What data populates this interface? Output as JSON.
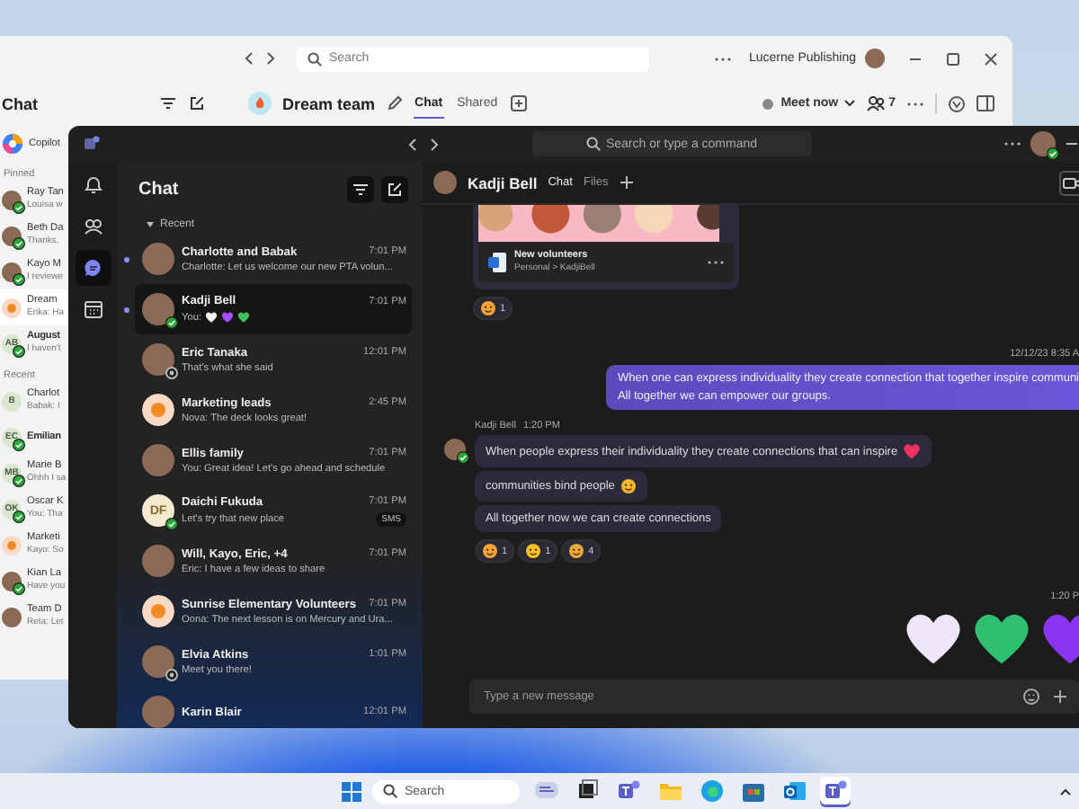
{
  "back_window": {
    "search": {
      "placeholder": "Search"
    },
    "account": "Lucerne Publishing",
    "sidebar": {
      "title": "Chat",
      "copilot": "Copilot",
      "sections": [
        {
          "title": "Pinned",
          "items": [
            {
              "name": "Ray Tan",
              "preview": "Louisa w",
              "avatar": {
                "kind": "photo"
              },
              "available": true,
              "unread": false,
              "selected": false
            },
            {
              "name": "Beth Da",
              "preview": "Thanks,",
              "avatar": {
                "kind": "photo"
              },
              "available": true,
              "unread": false,
              "selected": false
            },
            {
              "name": "Kayo M",
              "preview": "I reviewe",
              "avatar": {
                "kind": "photo"
              },
              "available": true,
              "unread": false,
              "selected": false
            },
            {
              "name": "Dream",
              "preview": "Erika: Ha",
              "avatar": {
                "kind": "icon"
              },
              "unread": false,
              "selected": true
            },
            {
              "name": "August",
              "preview": "I haven't",
              "avatar": {
                "kind": "initials",
                "text": "AB"
              },
              "available": true,
              "unread": true,
              "selected": false
            }
          ]
        },
        {
          "title": "Recent",
          "items": [
            {
              "name": "Charlot",
              "preview": "Babak: I",
              "avatar": {
                "kind": "initials",
                "text": "B"
              },
              "unread": false,
              "selected": false
            },
            {
              "name": "Emilian",
              "avatar": {
                "kind": "initials",
                "text": "EC"
              },
              "available": true,
              "unread": true,
              "selected": false
            },
            {
              "name": "Marie B",
              "preview": "Ohhh I sa",
              "avatar": {
                "kind": "initials",
                "text": "MB"
              },
              "available": true,
              "unread": false,
              "selected": false
            },
            {
              "name": "Oscar K",
              "preview": "You: Tha",
              "avatar": {
                "kind": "initials",
                "text": "OK"
              },
              "available": true,
              "unread": false,
              "selected": false
            },
            {
              "name": "Marketi",
              "preview": "Kayo: So",
              "avatar": {
                "kind": "icon"
              },
              "unread": false,
              "selected": false
            },
            {
              "name": "Kian La",
              "preview": "Have you",
              "avatar": {
                "kind": "photo"
              },
              "available": true,
              "unread": false,
              "selected": false
            },
            {
              "name": "Team D",
              "preview": "Reta: Let",
              "avatar": {
                "kind": "photo"
              },
              "unread": false,
              "selected": false
            }
          ]
        }
      ]
    },
    "conversation": {
      "title": "Dream team",
      "tabs": [
        {
          "label": "Chat",
          "selected": true
        },
        {
          "label": "Shared",
          "selected": false
        }
      ],
      "meet_now": "Meet now",
      "participants": "7"
    }
  },
  "front_window": {
    "search": {
      "placeholder": "Search or type a command"
    },
    "rail": [
      {
        "kind": "activity",
        "selected": false
      },
      {
        "kind": "communities",
        "selected": false
      },
      {
        "kind": "chat",
        "selected": true
      },
      {
        "kind": "calendar",
        "selected": false
      }
    ],
    "chat_list": {
      "title": "Chat",
      "section": "Recent",
      "items": [
        {
          "name": "Charlotte and Babak",
          "time": "7:01 PM",
          "preview": "Charlotte: Let us welcome our new PTA volun...",
          "avatar": {
            "kind": "photo"
          },
          "unread": true,
          "selected": false
        },
        {
          "name": "Kadji Bell",
          "time": "7:01 PM",
          "preview": "You:",
          "preview_hearts": [
            {
              "color": "#f2f2f2"
            },
            {
              "color": "#a64dff"
            },
            {
              "color": "#3fc25a"
            }
          ],
          "avatar": {
            "kind": "photo"
          },
          "available": true,
          "unread": true,
          "selected": true
        },
        {
          "name": "Eric Tanaka",
          "time": "12:01 PM",
          "preview": "That's what she said",
          "avatar": {
            "kind": "photo"
          },
          "available": false,
          "unread": false,
          "selected": false
        },
        {
          "name": "Marketing leads",
          "time": "2:45 PM",
          "preview": "Nova: The deck looks great!",
          "avatar": {
            "kind": "icon"
          },
          "unread": false,
          "selected": false
        },
        {
          "name": "Ellis family",
          "time": "7:01 PM",
          "preview": "You: Great idea! Let's go ahead and schedule",
          "avatar": {
            "kind": "photo"
          },
          "unread": false,
          "selected": false
        },
        {
          "name": "Daichi Fukuda",
          "time": "7:01 PM",
          "preview": "Let's try that new place",
          "badge": "SMS",
          "avatar": {
            "kind": "initials",
            "text": "DF"
          },
          "available": true,
          "unread": false,
          "selected": false
        },
        {
          "name": "Will, Kayo, Eric, +4",
          "time": "7:01 PM",
          "preview": "Eric: I have a few ideas to share",
          "avatar": {
            "kind": "photo"
          },
          "unread": false,
          "selected": false
        },
        {
          "name": "Sunrise Elementary Volunteers",
          "time": "7:01 PM",
          "preview": "Oona: The next lesson is on Mercury and Ura...",
          "avatar": {
            "kind": "icon"
          },
          "unread": false,
          "selected": false
        },
        {
          "name": "Elvia Atkins",
          "time": "1:01 PM",
          "preview": "Meet you there!",
          "avatar": {
            "kind": "photo"
          },
          "available": false,
          "unread": false,
          "selected": false
        },
        {
          "name": "Karin Blair",
          "time": "12:01 PM",
          "avatar": {
            "kind": "photo"
          },
          "unread": false,
          "selected": false
        }
      ]
    },
    "conversation": {
      "title": "Kadji Bell",
      "tabs": [
        {
          "label": "Chat",
          "selected": true
        },
        {
          "label": "Files",
          "selected": false
        }
      ],
      "messages": [
        {
          "kind": "attachment",
          "file": "New volunteers",
          "path": "Personal > KadjiBell",
          "reactions": [
            {
              "color": "#f7a23b",
              "count": "1"
            }
          ]
        },
        {
          "kind": "timestamp",
          "text": "12/12/23 8:35 A"
        },
        {
          "kind": "sent",
          "lines": [
            "When one can express individuality they create connection that together inspire communi",
            "All together we can empower our groups."
          ]
        },
        {
          "kind": "received_group",
          "sender": "Kadji Bell",
          "time": "1:20 PM",
          "available": true,
          "bubbles": [
            {
              "text": "When people express their individuality they create connections that can inspire",
              "emoji": {
                "color": "#f0325f"
              }
            },
            {
              "text": "communities bind people",
              "emoji": {
                "color": "#f5b52e"
              }
            },
            {
              "text": "All together now we can create connections"
            }
          ],
          "reactions": [
            {
              "color": "#f7a23b",
              "count": "1"
            },
            {
              "color": "#f5c026",
              "count": "1"
            },
            {
              "color": "#e9a73a",
              "count": "4"
            }
          ]
        },
        {
          "kind": "timestamp",
          "text": "1:20 P"
        },
        {
          "kind": "hearts",
          "hearts": [
            {
              "color": "#ece6f7"
            },
            {
              "color": "#2fbf71"
            },
            {
              "color": "#8a34ef"
            }
          ]
        }
      ],
      "compose": {
        "placeholder": "Type a new message"
      }
    }
  },
  "taskbar": {
    "search": {
      "placeholder": "Search"
    },
    "apps": [
      {
        "kind": "widgets",
        "selected": false
      },
      {
        "kind": "taskview",
        "selected": false
      },
      {
        "kind": "teams",
        "selected": false
      },
      {
        "kind": "explorer",
        "selected": false
      },
      {
        "kind": "browser",
        "selected": false
      },
      {
        "kind": "store",
        "selected": false
      },
      {
        "kind": "mail",
        "selected": false
      },
      {
        "kind": "teams",
        "selected": true
      }
    ]
  }
}
